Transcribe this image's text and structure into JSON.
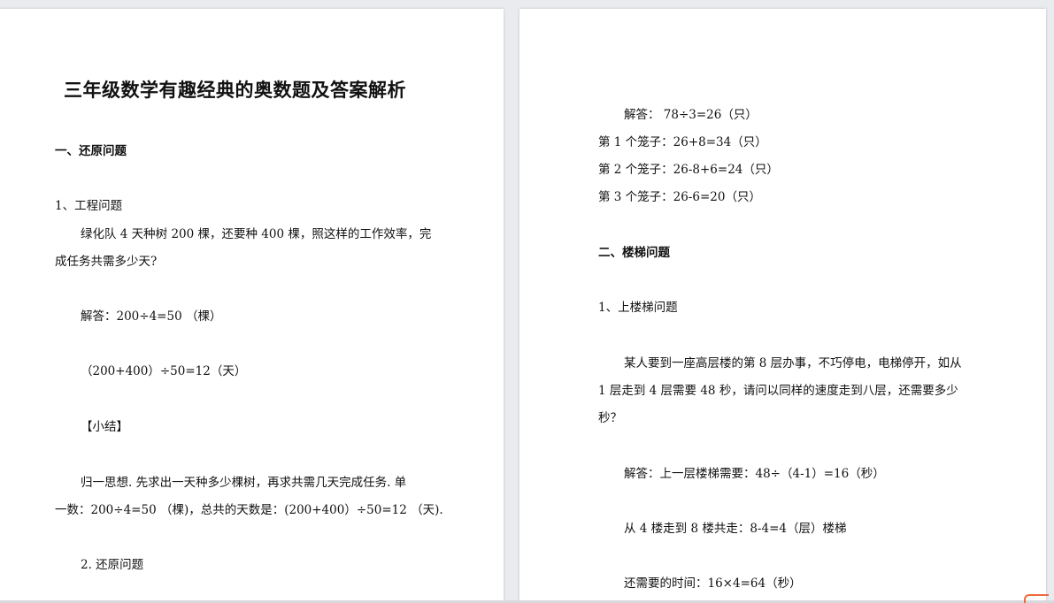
{
  "left_page": {
    "title": "三年级数学有趣经典的奥数题及答案解析",
    "section1_heading": "一、还原问题",
    "item1_title": "1、工程问题",
    "problem1_line1": "绿化队 4 天种树 200 棵，还要种 400 棵，照这样的工作效率，完",
    "problem1_line2": "成任务共需多少天?",
    "answer1_line1": "解答：200÷4=50  （棵）",
    "answer1_line2": "（200+400）÷50=12（天）",
    "summary_label": "【小结】",
    "summary_line1": "归一思想. 先求出一天种多少棵树，再求共需几天完成任务. 单",
    "summary_line2": "一数：200÷4=50 （棵)，总共的天数是：(200+400）÷50=12 （天).",
    "item2_title": "2. 还原问题"
  },
  "right_page": {
    "answer2_line1": "解答：      78÷3=26（只）",
    "cage1": "第 1 个笼子：26+8=34（只）",
    "cage2": "第 2 个笼子：26-8+6=24（只）",
    "cage3": "第 3 个笼子：26-6=20（只）",
    "section2_heading": "二、楼梯问题",
    "item3_title": "1、上楼梯问题",
    "problem3_line1": "某人要到一座高层楼的第 8 层办事，不巧停电，电梯停开，如从",
    "problem3_line2": "1 层走到 4 层需要 48 秒，请问以同样的速度走到八层，还需要多少",
    "problem3_line3": "秒？",
    "answer3_line1": "解答：上一层楼梯需要：48÷（4-1）=16（秒）",
    "answer3_line2": "从 4 楼走到 8 楼共走：8-4=4（层）楼梯",
    "answer3_line3": "还需要的时间：16×4=64（秒）"
  }
}
